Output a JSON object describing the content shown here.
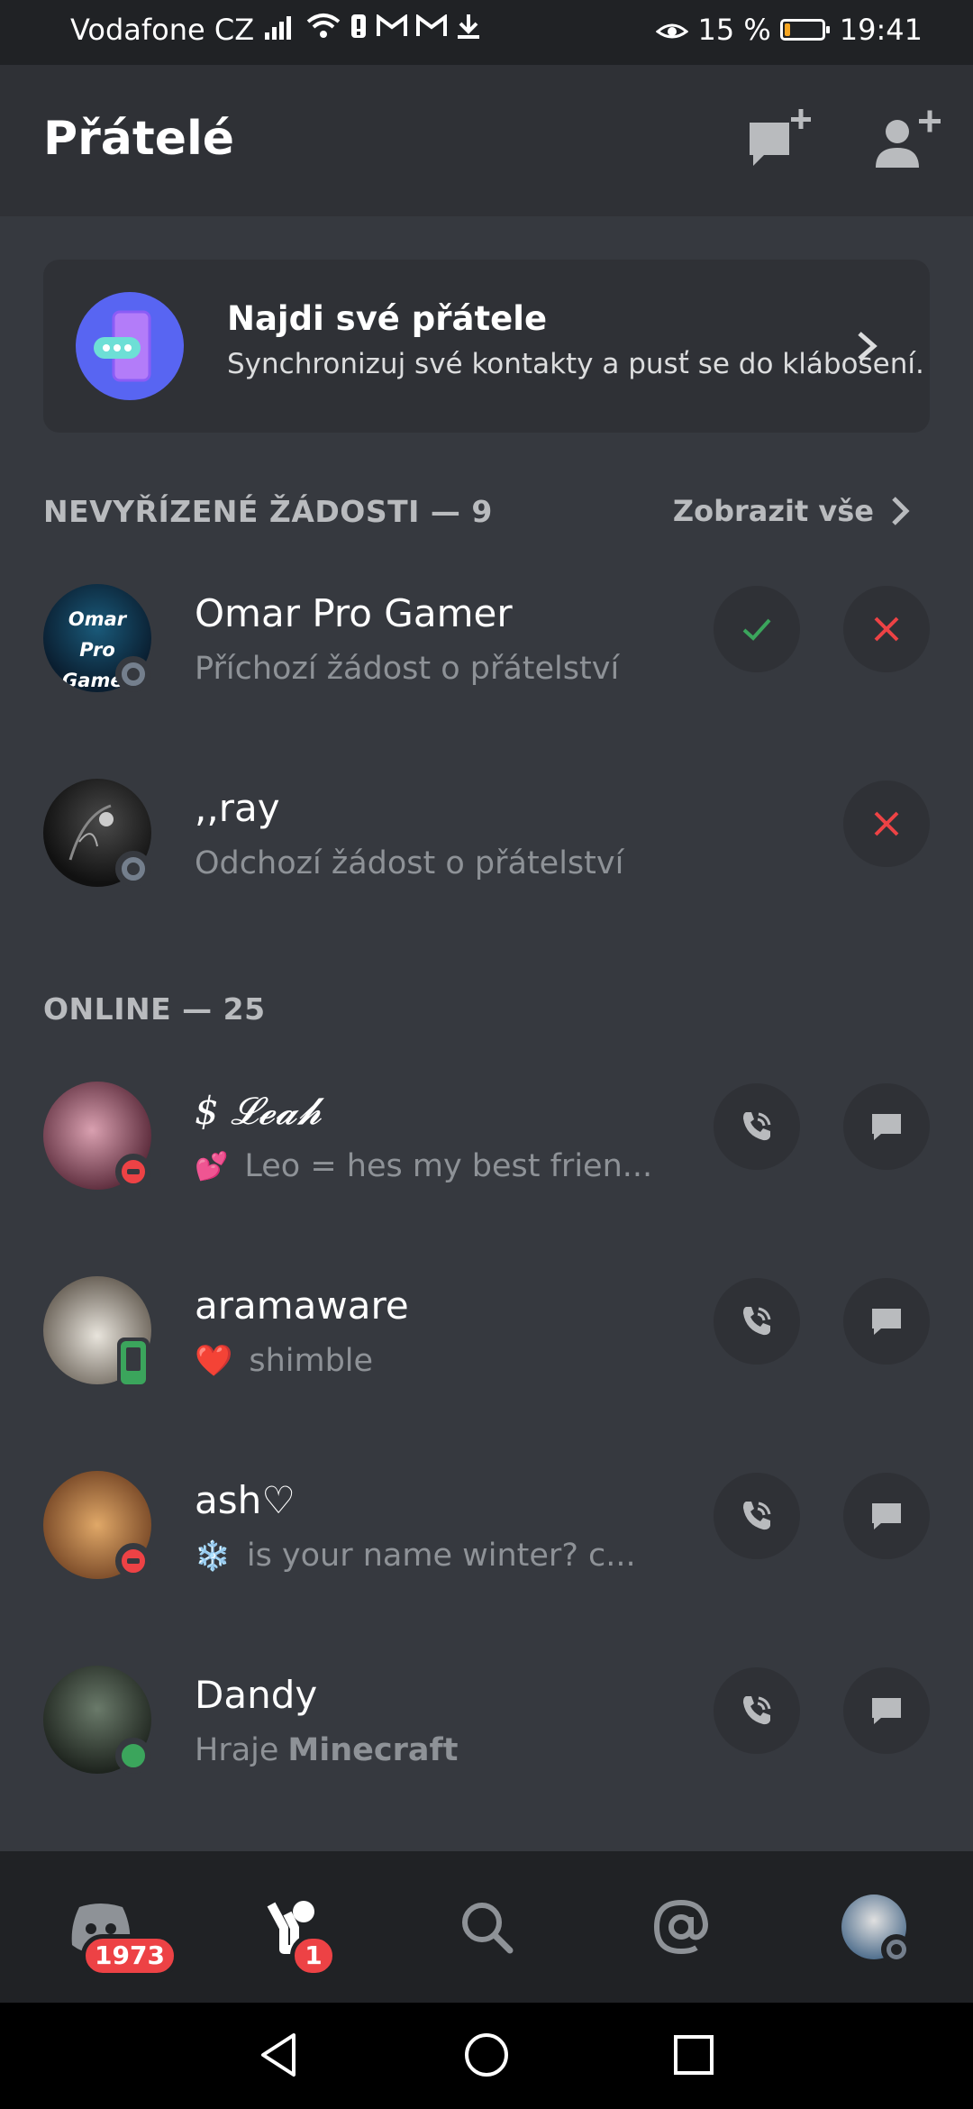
{
  "status_bar": {
    "carrier": "Vodafone CZ",
    "battery": "15 %",
    "battery_level": 0.15,
    "time": "19:41"
  },
  "header": {
    "title": "Přátelé",
    "actions": [
      "new-group-dm-icon",
      "add-friend-icon"
    ]
  },
  "find_friends": {
    "title": "Najdi své přátele",
    "subtitle": "Synchronizuj své kontakty a pusť se do klábosení."
  },
  "pending": {
    "heading": "NEVYŘÍZENÉ ŽÁDOSTI — 9",
    "see_all": "Zobrazit vše",
    "items": [
      {
        "name": "Omar Pro Gamer",
        "subtitle": "Příchozí žádost o přátelství",
        "avatar_text": "Omar Pro Gamer",
        "status": "offline"
      },
      {
        "name": ",,ray",
        "subtitle": "Odchozí žádost o přátelství",
        "status": "offline"
      }
    ]
  },
  "online": {
    "heading": "ONLINE — 25",
    "items": [
      {
        "name": "$ 𝓛𝓮𝓪𝓱",
        "status_text": "Leo = hes my best frien...",
        "emoji": "💕",
        "status": "dnd"
      },
      {
        "name": "aramaware",
        "status_text": "shimble",
        "emoji": "❤️",
        "status": "mobile"
      },
      {
        "name": "ash♡",
        "status_text": "is your name winter? c...",
        "emoji": "❄️",
        "status": "dnd"
      },
      {
        "name": "Dandy",
        "activity_prefix": "Hraje",
        "activity_name": "Minecraft",
        "status": "online"
      }
    ]
  },
  "bottom_nav": {
    "home_badge": "1973",
    "friends_badge": "1",
    "items": [
      "discord-home-icon",
      "friends-icon",
      "search-icon",
      "mention-icon",
      "profile-avatar"
    ]
  },
  "colors": {
    "background": "#36393f",
    "header": "#2f3136",
    "blurple": "#5865f2",
    "online": "#3ba55c",
    "dnd": "#ed4245",
    "accept": "#3ba55c",
    "decline": "#ed4245"
  }
}
